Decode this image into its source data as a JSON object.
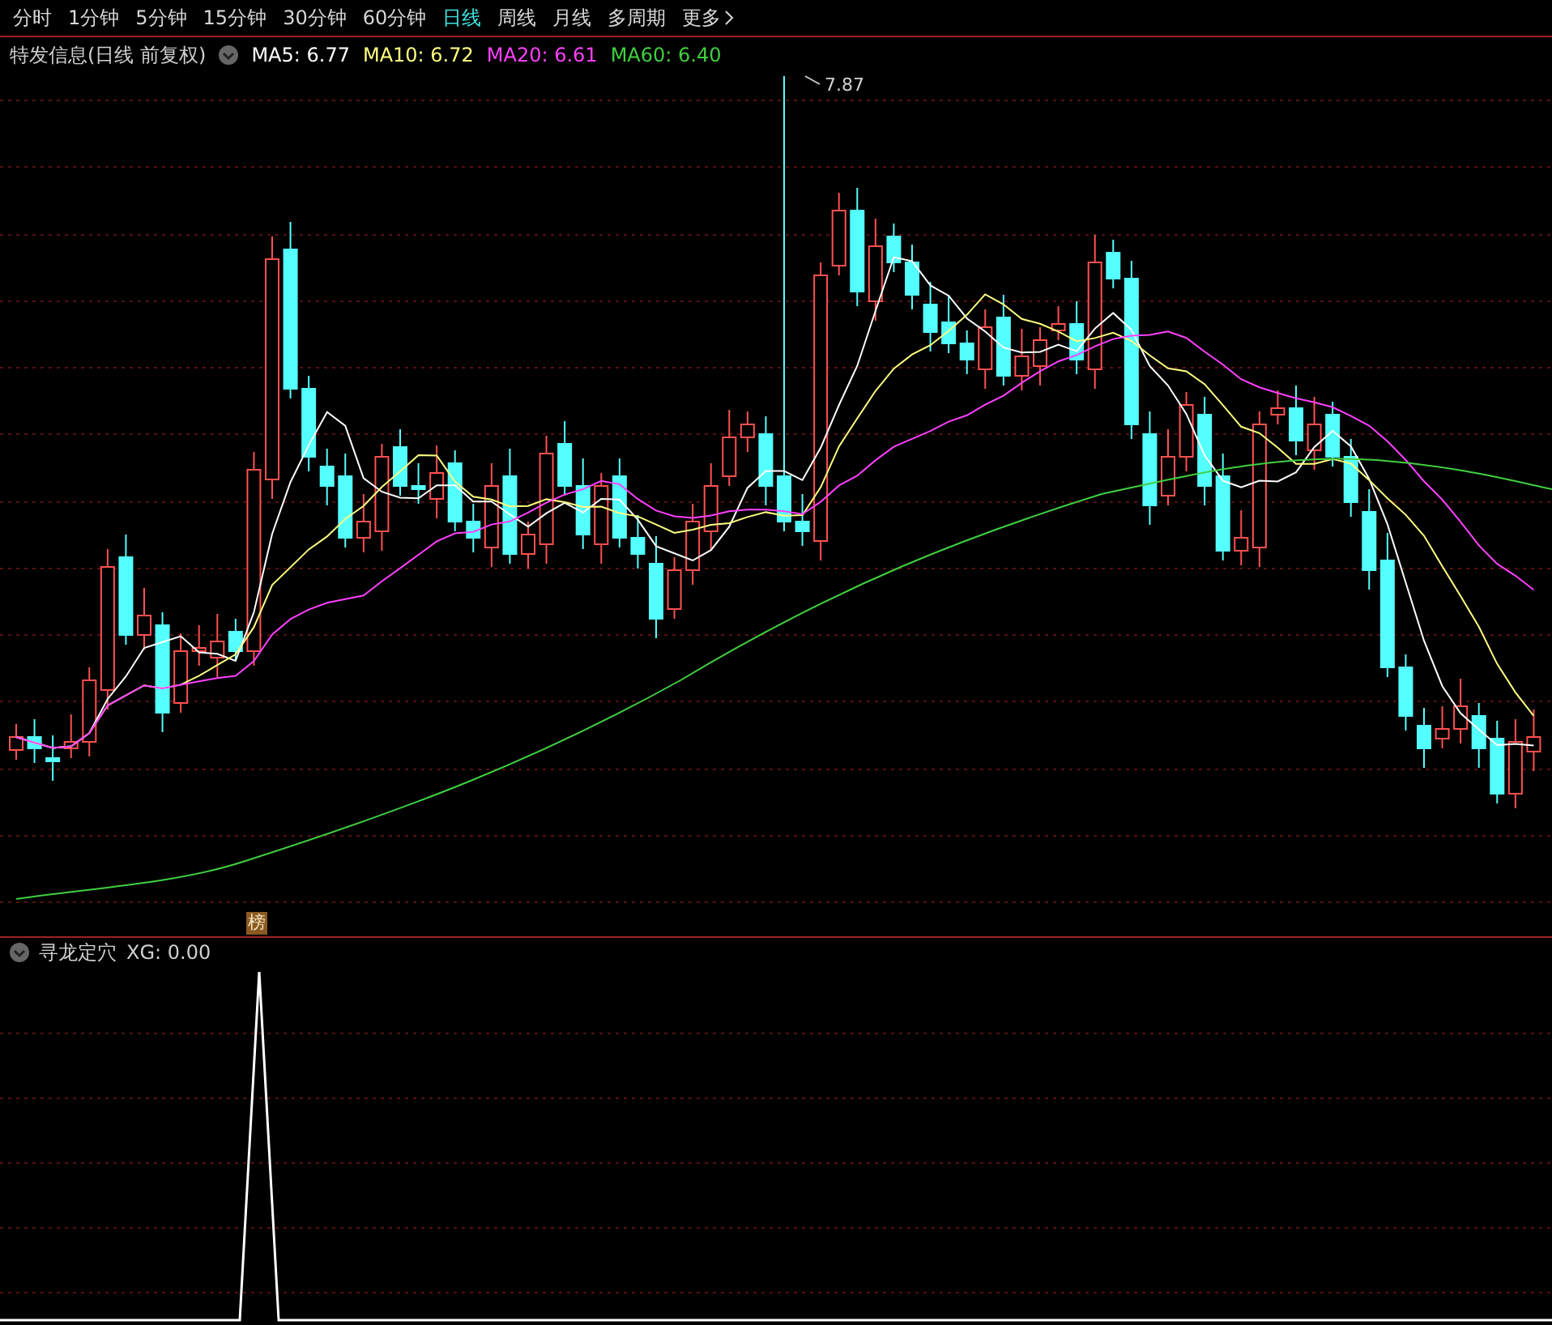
{
  "tabs": [
    {
      "label": "分时",
      "selected": false
    },
    {
      "label": "1分钟",
      "selected": false
    },
    {
      "label": "5分钟",
      "selected": false
    },
    {
      "label": "15分钟",
      "selected": false
    },
    {
      "label": "30分钟",
      "selected": false
    },
    {
      "label": "60分钟",
      "selected": false
    },
    {
      "label": "日线",
      "selected": true
    },
    {
      "label": "周线",
      "selected": false
    },
    {
      "label": "月线",
      "selected": false
    },
    {
      "label": "多周期",
      "selected": false
    },
    {
      "label": "更多",
      "selected": false
    }
  ],
  "chart_header": {
    "title": "特发信息(日线 前复权)",
    "indicators": [
      {
        "label": "MA5: 6.77",
        "color": "#ffffff"
      },
      {
        "label": "MA10: 6.72",
        "color": "#ffff80"
      },
      {
        "label": "MA20: 6.61",
        "color": "#ff40ff"
      },
      {
        "label": "MA60: 6.40",
        "color": "#40d040"
      }
    ]
  },
  "price_label": "7.87",
  "event_badge": "榜",
  "indicator_panel": {
    "title": "寻龙定穴",
    "value": "XG: 0.00"
  }
}
